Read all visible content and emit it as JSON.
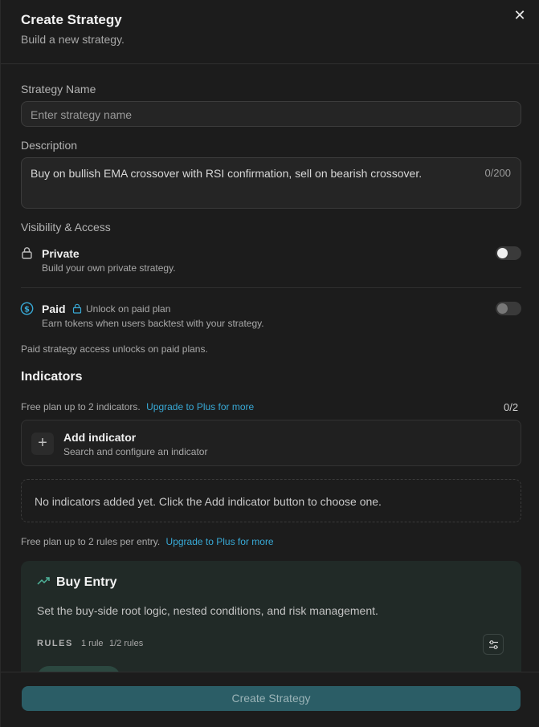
{
  "header": {
    "title": "Create Strategy",
    "subtitle": "Build a new strategy.",
    "close_icon": "close-icon"
  },
  "name": {
    "label": "Strategy Name",
    "placeholder": "Enter strategy name",
    "value": ""
  },
  "description": {
    "label": "Description",
    "value": "Buy on bullish EMA crossover with RSI confirmation, sell on bearish crossover.",
    "counter": "0/200"
  },
  "visibility": {
    "label": "Visibility & Access",
    "private": {
      "title": "Private",
      "subtitle": "Build your own private strategy.",
      "icon": "lock-icon",
      "enabled": false
    },
    "paid": {
      "title": "Paid",
      "lock_text": "Unlock on paid plan",
      "subtitle": "Earn tokens when users backtest with your strategy.",
      "icon": "dollar-circle-icon",
      "enabled": false
    },
    "note": "Paid strategy access unlocks on paid plans."
  },
  "indicators": {
    "title": "Indicators",
    "plan_note": "Free plan up to 2 indicators.",
    "upgrade_link": "Upgrade to Plus for more",
    "count": "0/2",
    "add": {
      "title": "Add indicator",
      "subtitle": "Search and configure an indicator"
    },
    "empty": "No indicators added yet. Click the Add indicator button to choose one."
  },
  "rules_note": {
    "text": "Free plan up to 2 rules per entry.",
    "upgrade_link": "Upgrade to Plus for more"
  },
  "buy_entry": {
    "title": "Buy Entry",
    "icon": "trending-up-icon",
    "description": "Set the buy-side root logic, nested conditions, and risk management.",
    "rules_label": "RULES",
    "rule_count": "1 rule",
    "rule_limit": "1/2 rules",
    "settings_icon": "sliders-icon"
  },
  "footer": {
    "create_label": "Create Strategy"
  },
  "colors": {
    "accent": "#38a9d6",
    "button": "#2b5d66",
    "background": "#1c1c1c"
  }
}
